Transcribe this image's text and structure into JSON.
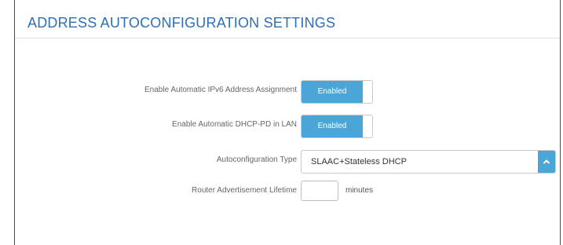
{
  "section": {
    "title": "ADDRESS AUTOCONFIGURATION SETTINGS"
  },
  "fields": {
    "auto_ipv6": {
      "label": "Enable Automatic IPv6 Address Assignment",
      "value": "Enabled"
    },
    "auto_dhcp_pd": {
      "label": "Enable Automatic DHCP-PD in LAN",
      "value": "Enabled"
    },
    "autoconfig_type": {
      "label": "Autoconfiguration Type",
      "value": "SLAAC+Stateless DHCP"
    },
    "ra_lifetime": {
      "label": "Router Advertisement Lifetime",
      "value": "",
      "unit": "minutes"
    }
  },
  "colors": {
    "accent": "#4aa6d6",
    "title": "#2f6fb4"
  },
  "icons": {
    "select_arrow": "chevron-up-icon"
  }
}
